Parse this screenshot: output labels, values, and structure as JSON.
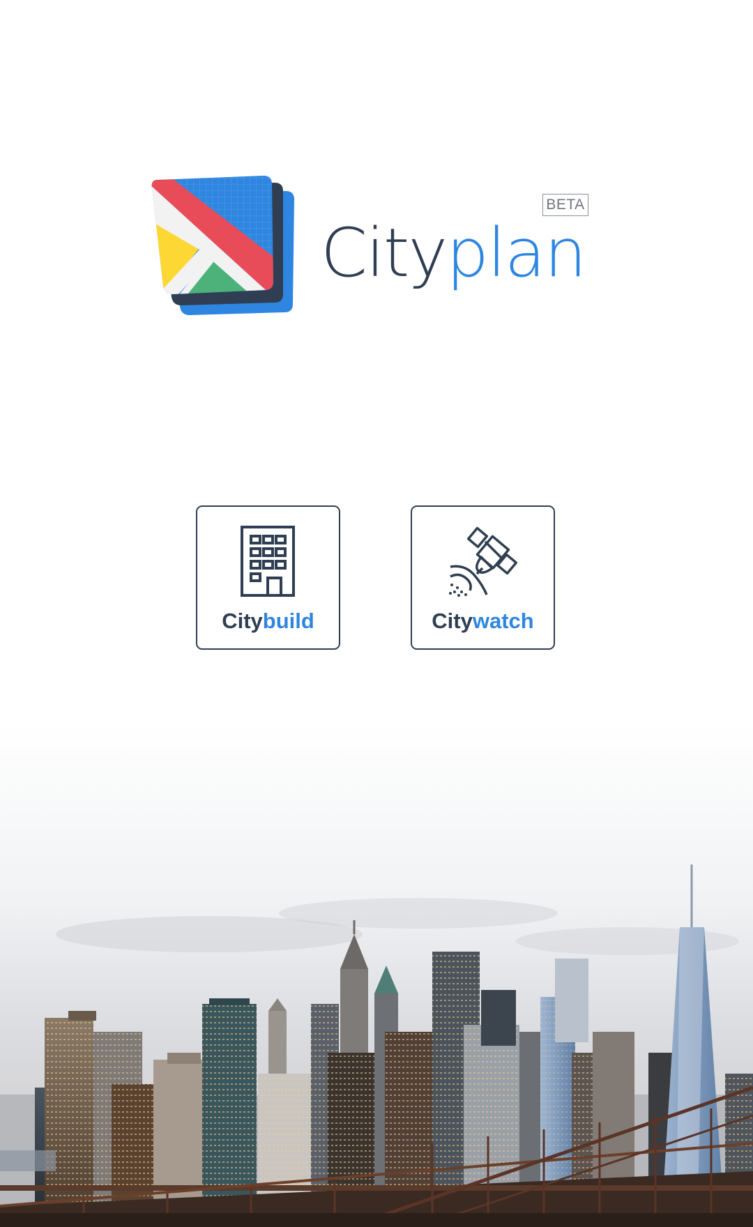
{
  "app": {
    "name_part1": "City",
    "name_part2": "plan",
    "badge": "BETA"
  },
  "colors": {
    "dark": "#2f3e52",
    "accent": "#2f86e0",
    "logo_red": "#e84c58",
    "logo_yellow": "#fdd835",
    "logo_green": "#4cb27a",
    "logo_blue": "#2f86e0"
  },
  "modules": [
    {
      "id": "citybuild",
      "label_part1": "City",
      "label_part2": "build",
      "icon": "building-icon"
    },
    {
      "id": "citywatch",
      "label_part1": "City",
      "label_part2": "watch",
      "icon": "satellite-icon"
    }
  ],
  "background": {
    "image": "city-skyline-photo"
  }
}
